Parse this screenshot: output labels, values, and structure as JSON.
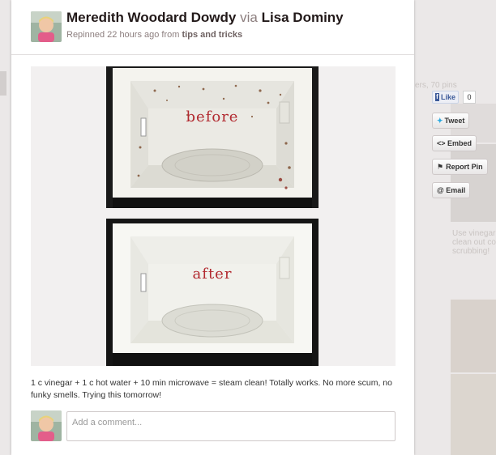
{
  "pin": {
    "pinner_name": "Meredith Woodard Dowdy",
    "via_word": "via",
    "source_name": "Lisa Dominy",
    "repinned_text": "Repinned 22 hours ago from",
    "board_name": "tips and tricks",
    "before_label": "before",
    "after_label": "after",
    "description": "1 c vinegar + 1 c hot water + 10 min microwave = steam clean! Totally works. No more scum, no funky smells. Trying this tomorrow!",
    "comment_placeholder": "Add a comment..."
  },
  "share": {
    "like_label": "Like",
    "like_count": "0",
    "tweet_label": "Tweet",
    "embed_label": "<> Embed",
    "report_label": "Report Pin",
    "email_label": "@ Email"
  },
  "background": {
    "pins_fragment": "ers, 70 pins",
    "caption_fragment": "Use vinegar a\nclean out coo\nscrubbing!"
  },
  "colors": {
    "label_red": "#b22a30",
    "title_dark": "#221919",
    "muted": "#8c7e7e",
    "facebook": "#3b5998",
    "twitter": "#2aa9e0"
  },
  "icons": [
    "avatar",
    "facebook-icon",
    "twitter-bird-icon",
    "flag-icon"
  ]
}
